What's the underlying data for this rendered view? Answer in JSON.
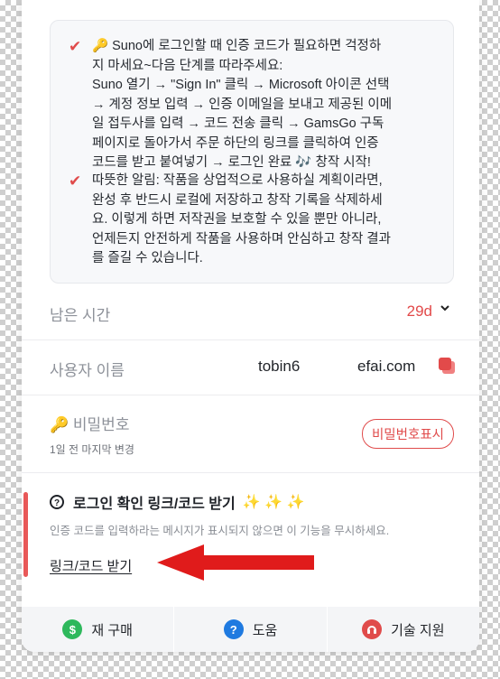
{
  "notice": {
    "items": [
      {
        "lines": [
          "🔑 Suno에 로그인할 때 인증 코드가 필요하면 걱정하",
          "지 마세요~다음 단계를 따라주세요:",
          "Suno 열기 → \"Sign In\" 클릭 → Microsoft 아이콘 선택",
          "→ 계정 정보 입력 → 인증 이메일을 보내고 제공된 이메",
          "일 접두사를 입력 → 코드 전송 클릭 → GamsGo 구독",
          "페이지로 돌아가서 주문 하단의 링크를 클릭하여 인증",
          "코드를 받고 붙여넣기 → 로그인 완료 🎶 창작 시작!"
        ]
      },
      {
        "lines": [
          "따뜻한 알림: 작품을 상업적으로 사용하실 계획이라면,",
          "완성 후 반드시 로컬에 저장하고 창작 기록을 삭제하세",
          "요. 이렇게 하면 저작권을 보호할 수 있을 뿐만 아니라,",
          "언제든지 안전하게 작품을 사용하며 안심하고 창작 결과",
          "를 즐길 수 있습니다."
        ]
      }
    ]
  },
  "remaining": {
    "label": "남은 시간",
    "value": "29d"
  },
  "username": {
    "label": "사용자 이름",
    "value": "tobin6",
    "email_fragment": "efai.com"
  },
  "password": {
    "icon_label": "🔑",
    "label": "비밀번호",
    "changed_note": "1일 전 마지막 변경",
    "show_button": "비밀번호표시"
  },
  "login_confirm": {
    "title": "로그인 확인 링크/코드 받기",
    "sparkles": "✨ ✨ ✨",
    "description": "인증 코드를 입력하라는 메시지가 표시되지 않으면 이 기능을 무시하세요.",
    "link_label": "링크/코드 받기"
  },
  "footer": {
    "items": [
      {
        "label": "재 구매",
        "icon": "dollar-icon",
        "color": "#2eb85c"
      },
      {
        "label": "도움",
        "icon": "help-icon",
        "color": "#1f7ae0"
      },
      {
        "label": "기술 지원",
        "icon": "support-icon",
        "color": "#e04b4b"
      }
    ]
  },
  "colors": {
    "accent": "#e04b4b",
    "arrow": "#e01b1b"
  }
}
